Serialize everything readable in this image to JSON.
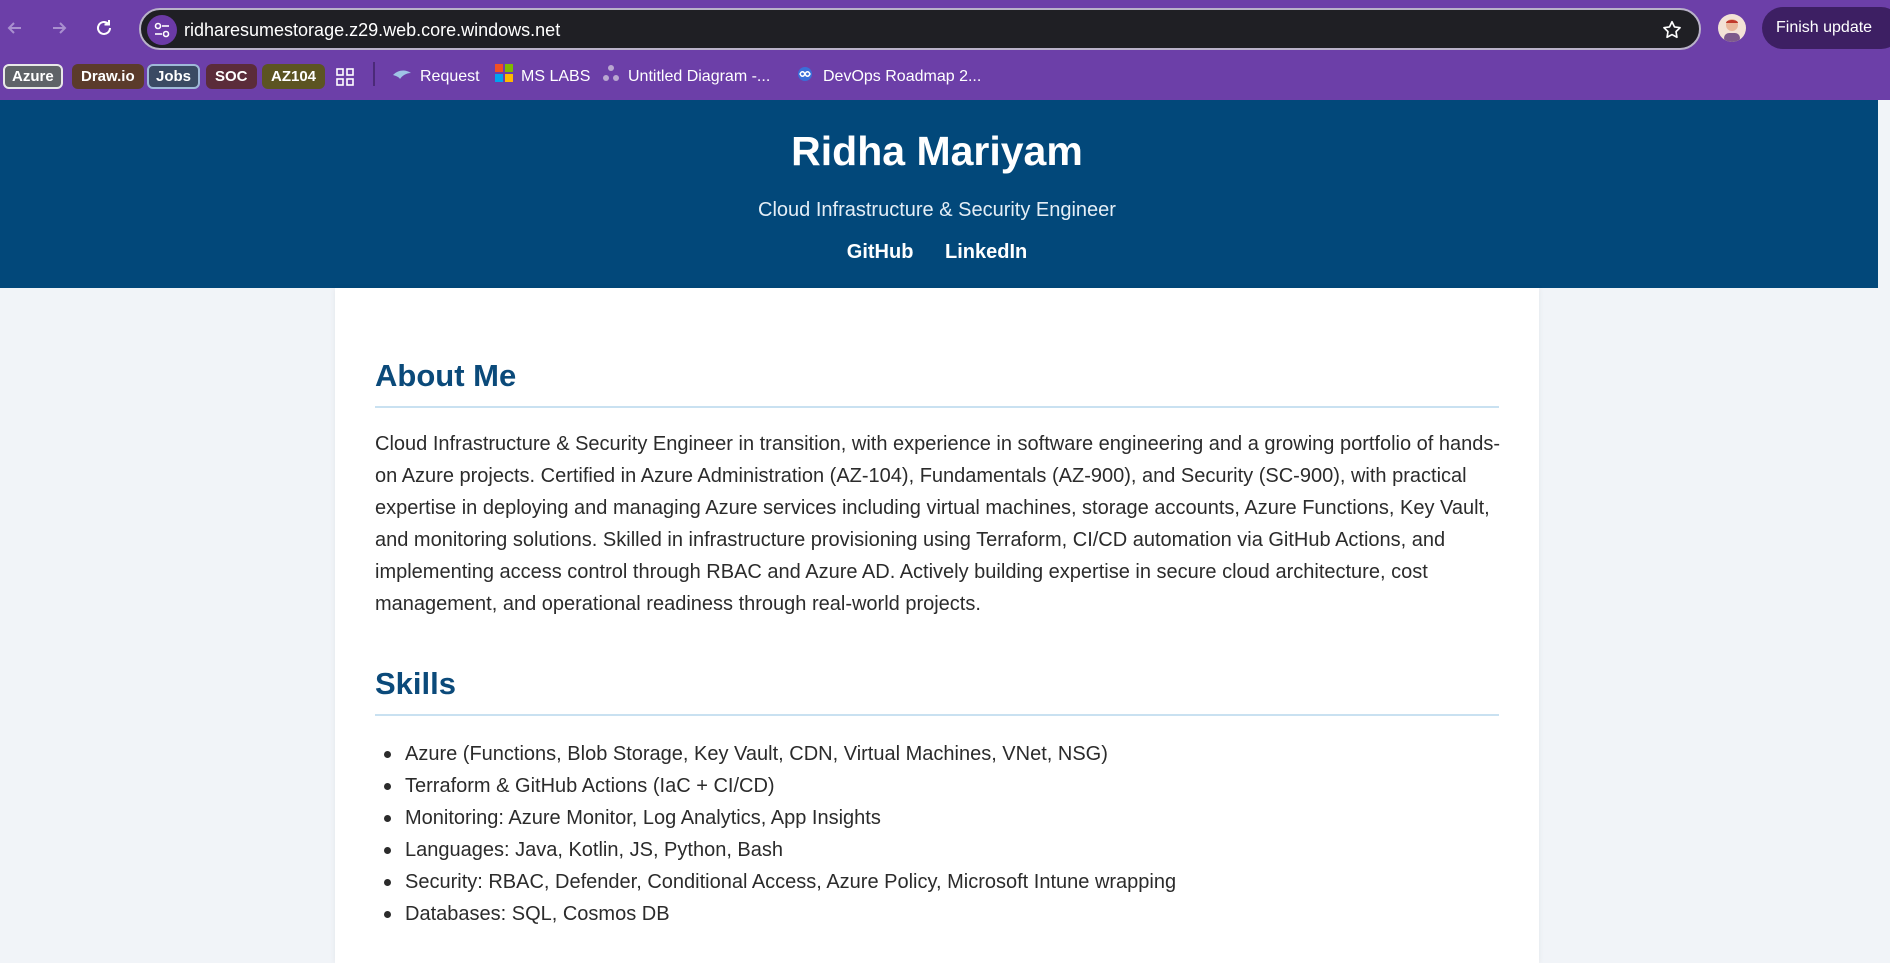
{
  "browser": {
    "url": "ridharesumestorage.z29.web.core.windows.net",
    "finish_update_label": "Finish update",
    "icons": {
      "back": "arrow-left-icon",
      "forward": "arrow-right-icon",
      "reload": "reload-icon",
      "site_info": "tune-icon",
      "bookmark_star": "star-icon",
      "profile": "avatar"
    }
  },
  "bookmarks": {
    "chips": [
      {
        "label": "Azure",
        "bg": "#5f6368",
        "border": "#e8e8e8"
      },
      {
        "label": "Draw.io",
        "bg": "#5b3b2b",
        "border": "#5b3b2b"
      },
      {
        "label": "Jobs",
        "bg": "#3a4a63",
        "border": "#9fb9d8"
      },
      {
        "label": "SOC",
        "bg": "#5b2c3a",
        "border": "#5b2c3a"
      },
      {
        "label": "AZ104",
        "bg": "#5c5422",
        "border": "#5c5422"
      }
    ],
    "apps_icon": "apps-grid-icon",
    "links": [
      {
        "label": "Request",
        "icon": "shark-icon"
      },
      {
        "label": "MS LABS",
        "icon": "microsoft-logo-icon"
      },
      {
        "label": "Untitled Diagram -...",
        "icon": "diagram-icon"
      },
      {
        "label": "DevOps Roadmap 2...",
        "icon": "infinity-icon"
      }
    ]
  },
  "header": {
    "name": "Ridha Mariyam",
    "subtitle": "Cloud Infrastructure & Security Engineer",
    "links": [
      "GitHub",
      "LinkedIn"
    ]
  },
  "about": {
    "title": "About Me",
    "text": "Cloud Infrastructure & Security Engineer in transition, with experience in software engineering and a growing portfolio of hands-on Azure projects. Certified in Azure Administration (AZ-104), Fundamentals (AZ-900), and Security (SC-900), with practical expertise in deploying and managing Azure services including virtual machines, storage accounts, Azure Functions, Key Vault, and monitoring solutions. Skilled in infrastructure provisioning using Terraform, CI/CD automation via GitHub Actions, and implementing access control through RBAC and Azure AD. Actively building expertise in secure cloud architecture, cost management, and operational readiness through real-world projects."
  },
  "skills": {
    "title": "Skills",
    "items": [
      "Azure (Functions, Blob Storage, Key Vault, CDN, Virtual Machines, VNet, NSG)",
      "Terraform & GitHub Actions (IaC + CI/CD)",
      "Monitoring: Azure Monitor, Log Analytics, App Insights",
      "Languages: Java, Kotlin, JS, Python, Bash",
      "Security: RBAC, Defender, Conditional Access, Azure Policy, Microsoft Intune wrapping",
      "Databases: SQL, Cosmos DB"
    ]
  },
  "colors": {
    "chrome": "#6c3fa8",
    "header_bg": "#02487a",
    "heading": "#0b4a7a",
    "page_bg": "#f1f4f8"
  }
}
